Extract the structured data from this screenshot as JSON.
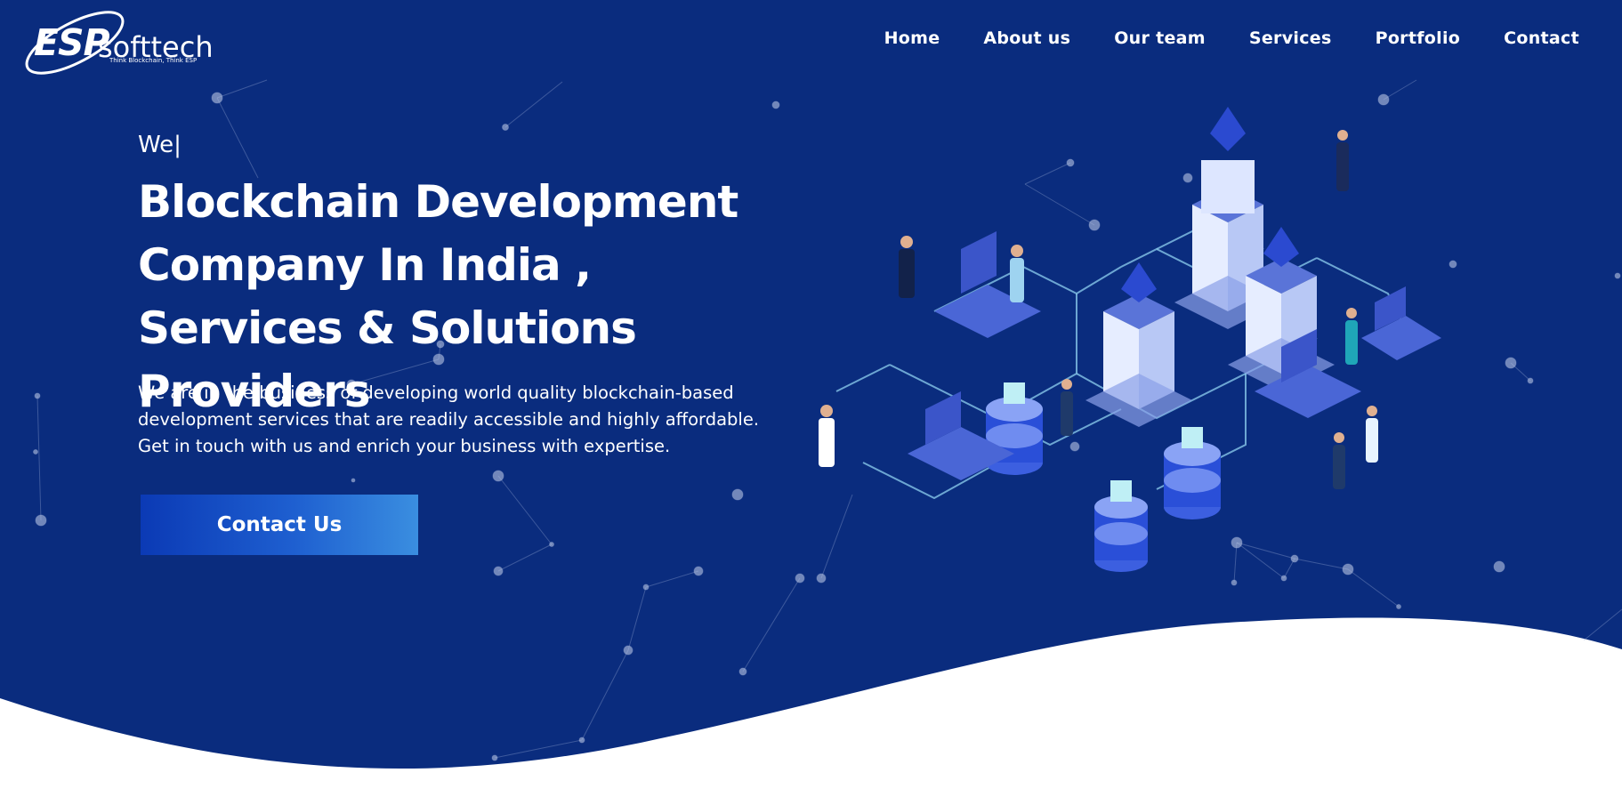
{
  "brand": {
    "logo_text": "ESP",
    "logo_suffix": "softtech",
    "tagline": "Think Blockchain, Think ESP"
  },
  "nav": {
    "items": [
      "Home",
      "About us",
      "Our team",
      "Services",
      "Portfolio",
      "Contact"
    ]
  },
  "hero": {
    "typed_text": "We|",
    "title": "Blockchain Development Company In India , Services & Solutions Providers",
    "description": "We are in the business of developing world quality blockchain-based development services that are readily accessible and highly affordable. Get in touch with us and enrich your business with expertise.",
    "cta_label": "Contact Us"
  },
  "colors": {
    "background": "#0a2c7e",
    "accent": "#1e5fd0",
    "text": "#ffffff"
  },
  "icons": {
    "illustration": "blockchain-network-illustration",
    "logo": "esp-softtech-logo"
  }
}
